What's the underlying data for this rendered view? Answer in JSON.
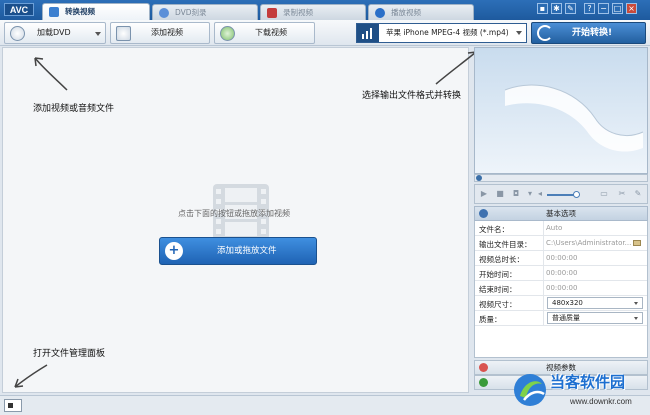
{
  "app": {
    "logo": "AVC"
  },
  "tabs": [
    {
      "label": "转换视频",
      "active": true
    },
    {
      "label": "DVD刻录",
      "active": false
    },
    {
      "label": "录制视频",
      "active": false
    },
    {
      "label": "播放视频",
      "active": false
    }
  ],
  "window_controls": [
    "?",
    "−",
    "□",
    "×"
  ],
  "toolbar": {
    "load_dvd": "加载DVD",
    "add_video": "添加视频",
    "download_video": "下载视频",
    "output_format": "苹果 iPhone MPEG-4 视频 (*.mp4)",
    "convert": "开始转换!"
  },
  "hints": {
    "add_file": "添加视频或音频文件",
    "select_format": "选择输出文件格式并转换",
    "open_panel": "打开文件管理面板"
  },
  "main": {
    "empty_tip": "点击下面的按钮或拖放添加视频",
    "add_button": "添加或拖放文件"
  },
  "options": {
    "header": "基本选项",
    "rows": [
      {
        "label": "文件名：",
        "value": "Auto"
      },
      {
        "label": "输出文件目录：",
        "value": "C:\\Users\\Administrator..."
      },
      {
        "label": "视频总时长：",
        "value": "00:00:00"
      },
      {
        "label": "开始时间：",
        "value": "00:00:00"
      },
      {
        "label": "结束时间：",
        "value": "00:00:00"
      },
      {
        "label": "视频尺寸：",
        "value": "480x320"
      },
      {
        "label": "质量：",
        "value": "普通质量"
      }
    ]
  },
  "video_params": "视频参数",
  "watermark": {
    "name": "当客软件园",
    "url": "www.downkr.com"
  },
  "colors": {
    "accent": "#1f63b4",
    "titlebar": "#2c6fb8"
  },
  "icons": [
    "disc-icon",
    "film-add-icon",
    "download-globe-icon",
    "phone-format-icon",
    "convert-refresh-icon",
    "filmstrip-icon",
    "plus-icon",
    "play-icon",
    "volume-icon",
    "settings-icon"
  ]
}
